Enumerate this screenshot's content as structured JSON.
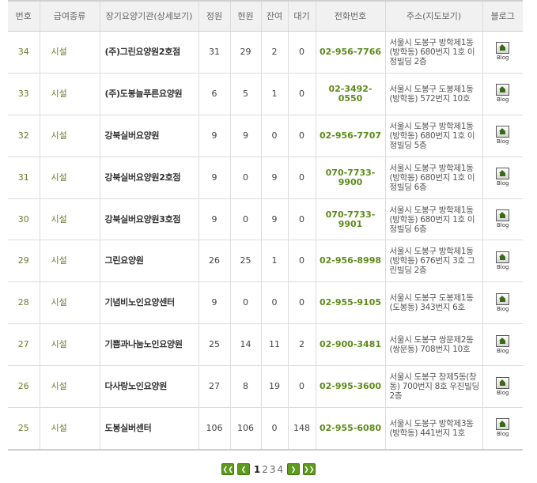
{
  "columns": {
    "no": "번호",
    "type": "급여종류",
    "name": "장기요양기관(상세보기)",
    "capacity": "정원",
    "current": "현원",
    "remaining": "잔여",
    "waiting": "대기",
    "phone": "전화번호",
    "address": "주소(지도보기)",
    "blog": "블로그"
  },
  "rows": [
    {
      "no": "34",
      "type": "시설",
      "name": "(주)그린요양원2호점",
      "capacity": "31",
      "current": "29",
      "remaining": "2",
      "waiting": "0",
      "phone": "02-956-7766",
      "address": "서울시 도봉구 방학제1동(방학동) 680번지 1호 이정빌딩 2층",
      "blog": "Blog"
    },
    {
      "no": "33",
      "type": "시설",
      "name": "(주)도봉늘푸른요양원",
      "capacity": "6",
      "current": "5",
      "remaining": "1",
      "waiting": "0",
      "phone": "02-3492-0550",
      "address": "서울시 도봉구 도봉제1동(방학동) 572번지 10호",
      "blog": "Blog"
    },
    {
      "no": "32",
      "type": "시설",
      "name": "강북실버요양원",
      "capacity": "9",
      "current": "9",
      "remaining": "0",
      "waiting": "0",
      "phone": "02-956-7707",
      "address": "서울시 도봉구 방학제1동(방학동) 680번지 1호 이정빌딩 5층",
      "blog": "Blog"
    },
    {
      "no": "31",
      "type": "시설",
      "name": "강북실버요양원2호점",
      "capacity": "9",
      "current": "0",
      "remaining": "9",
      "waiting": "0",
      "phone": "070-7733-9900",
      "address": "서울시 도봉구 방학제1동(방학동) 680번지 1호 이정빌딩 6층",
      "blog": "Blog"
    },
    {
      "no": "30",
      "type": "시설",
      "name": "강북실버요양원3호점",
      "capacity": "9",
      "current": "0",
      "remaining": "9",
      "waiting": "0",
      "phone": "070-7733-9901",
      "address": "서울시 도봉구 방학제1동(방학동) 680번지 1호 이정빌딩 6층",
      "blog": "Blog"
    },
    {
      "no": "29",
      "type": "시설",
      "name": "그린요양원",
      "capacity": "26",
      "current": "25",
      "remaining": "1",
      "waiting": "0",
      "phone": "02-956-8998",
      "address": "서울시 도봉구 방학제1동(방학동) 676번지 3호 그린빌딩 2층",
      "blog": "Blog"
    },
    {
      "no": "28",
      "type": "시설",
      "name": "기념비노인요양센터",
      "capacity": "9",
      "current": "0",
      "remaining": "0",
      "waiting": "0",
      "phone": "02-955-9105",
      "address": "서울시 도봉구 도봉제1동(도봉동) 343번지 6호",
      "blog": "Blog"
    },
    {
      "no": "27",
      "type": "시설",
      "name": "기쁨과나눔노인요양원",
      "capacity": "25",
      "current": "14",
      "remaining": "11",
      "waiting": "2",
      "phone": "02-900-3481",
      "address": "서울시 도봉구 쌍문제2동(쌍문동) 708번지 10호",
      "blog": "Blog"
    },
    {
      "no": "26",
      "type": "시설",
      "name": "다사랑노인요양원",
      "capacity": "27",
      "current": "8",
      "remaining": "19",
      "waiting": "0",
      "phone": "02-995-3600",
      "address": "서울시 도봉구 창제5동(창동) 700번지 8호 우진빌딩 2층",
      "blog": "Blog"
    },
    {
      "no": "25",
      "type": "시설",
      "name": "도봉실버센터",
      "capacity": "106",
      "current": "106",
      "remaining": "0",
      "waiting": "148",
      "phone": "02-955-6080",
      "address": "서울시 도봉구 방학제3동(방학동) 441번지 1호",
      "blog": "Blog"
    }
  ],
  "pagination": {
    "first_icon": "double-left-arrow",
    "prev_icon": "left-arrow",
    "pages": [
      "1",
      "2",
      "3",
      "4"
    ],
    "current_page": "1",
    "next_icon": "right-arrow",
    "last_icon": "double-right-arrow",
    "button_color": "#5d9a1e"
  },
  "colors": {
    "phone": "#5d8a1a",
    "number": "#6b7b2c",
    "header_bg": "#f1f1f1"
  }
}
